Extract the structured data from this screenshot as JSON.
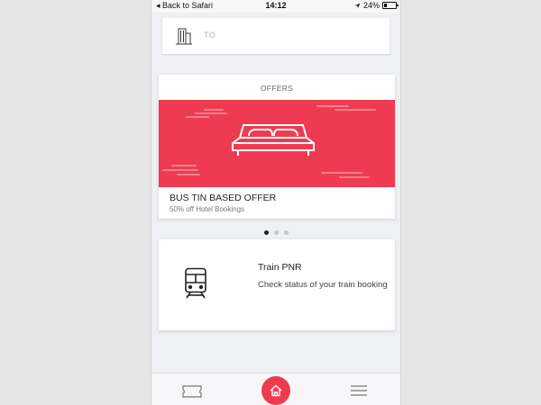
{
  "status_bar": {
    "back_label": "◂ Back to Safari",
    "time": "14:12",
    "location_icon": "location-arrow-icon",
    "battery": "24%"
  },
  "search": {
    "to_placeholder": "TO",
    "icon": "building-icon"
  },
  "offers": {
    "header": "OFFERS",
    "banner_icon": "bed-icon",
    "banner_color": "#ef3b51",
    "title": "BUS TIN BASED OFFER",
    "subtitle": "50% off Hotel Bookings",
    "carousel_active_index": 0,
    "carousel_total": 3
  },
  "train_card": {
    "icon": "train-icon",
    "title": "Train PNR",
    "description": "Check status of your train booking"
  },
  "bottom_nav": {
    "items": [
      "ticket-icon",
      "home-icon",
      "menu-icon"
    ],
    "active": "home",
    "accent": "#ef3b51"
  }
}
